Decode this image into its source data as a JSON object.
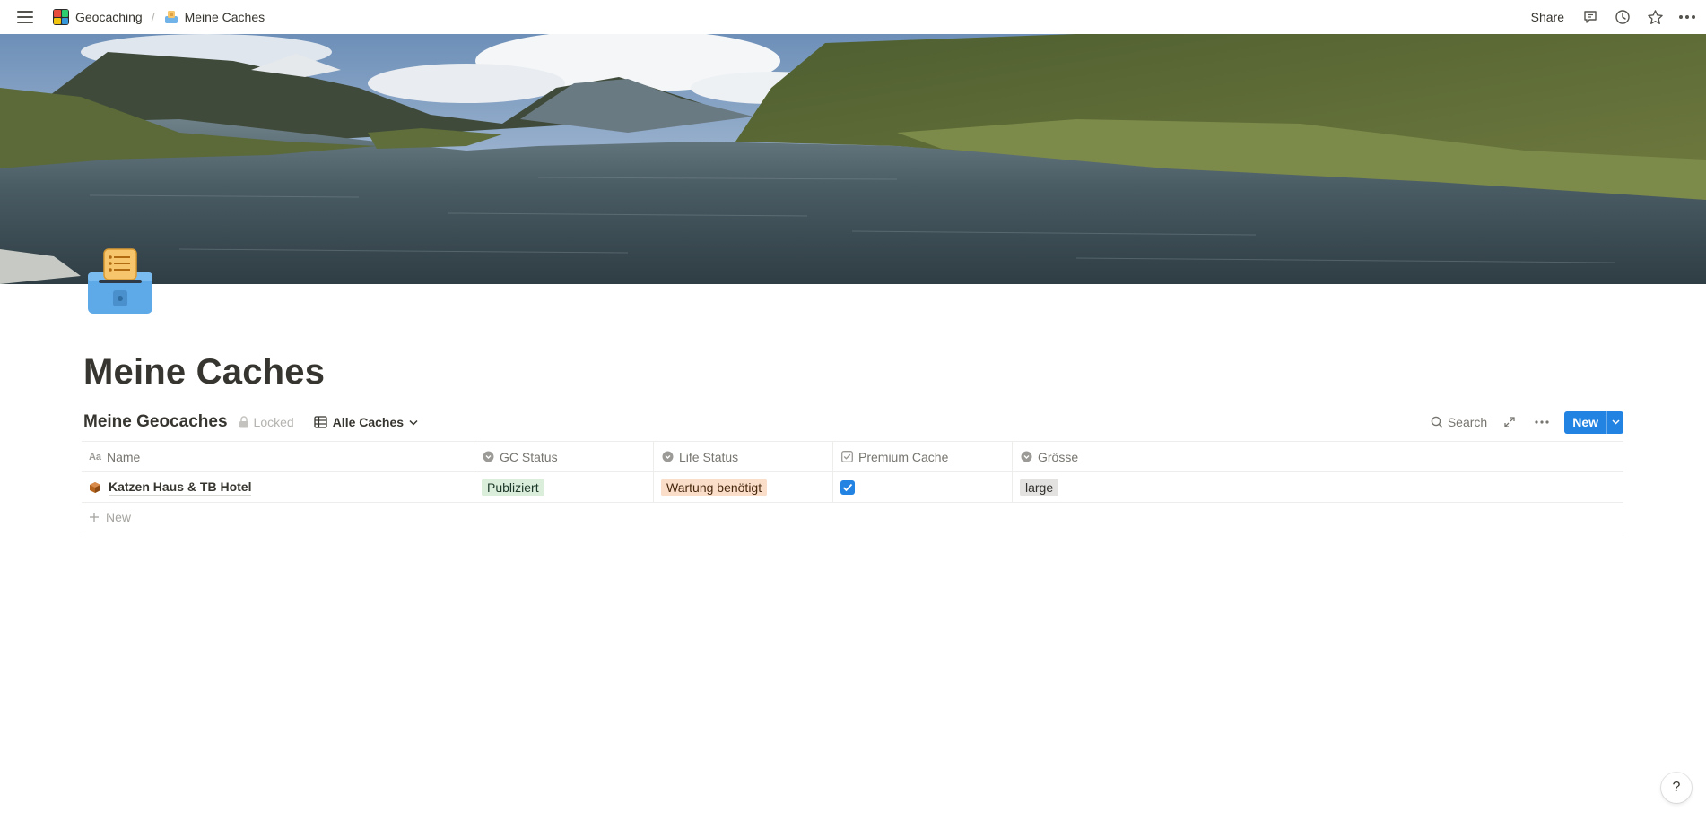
{
  "topbar": {
    "breadcrumb": [
      {
        "label": "Geocaching",
        "icon": "workspace-icon"
      },
      {
        "label": "Meine Caches",
        "icon": "page-icon"
      }
    ],
    "separator": "/",
    "share_label": "Share"
  },
  "page": {
    "title": "Meine Caches",
    "cover": "mountain-lake-landscape"
  },
  "database": {
    "title": "Meine Geocaches",
    "locked_label": "Locked",
    "view_name": "Alle Caches",
    "search_label": "Search",
    "new_label": "New",
    "columns": [
      {
        "label": "Name",
        "icon": "text-icon"
      },
      {
        "label": "GC Status",
        "icon": "select-icon"
      },
      {
        "label": "Life Status",
        "icon": "select-icon"
      },
      {
        "label": "Premium Cache",
        "icon": "checkbox-icon"
      },
      {
        "label": "Grösse",
        "icon": "select-icon"
      }
    ],
    "rows": [
      {
        "name": "Katzen Haus & TB Hotel",
        "gc_status": "Publiziert",
        "life_status": "Wartung benötigt",
        "premium": true,
        "groesse": "large"
      }
    ],
    "add_row_label": "New"
  },
  "help_label": "?",
  "colors": {
    "accent": "#2383e2",
    "tag_green": "#dbeddb",
    "tag_orange": "#fadec9",
    "tag_gray": "#e3e2e0"
  }
}
